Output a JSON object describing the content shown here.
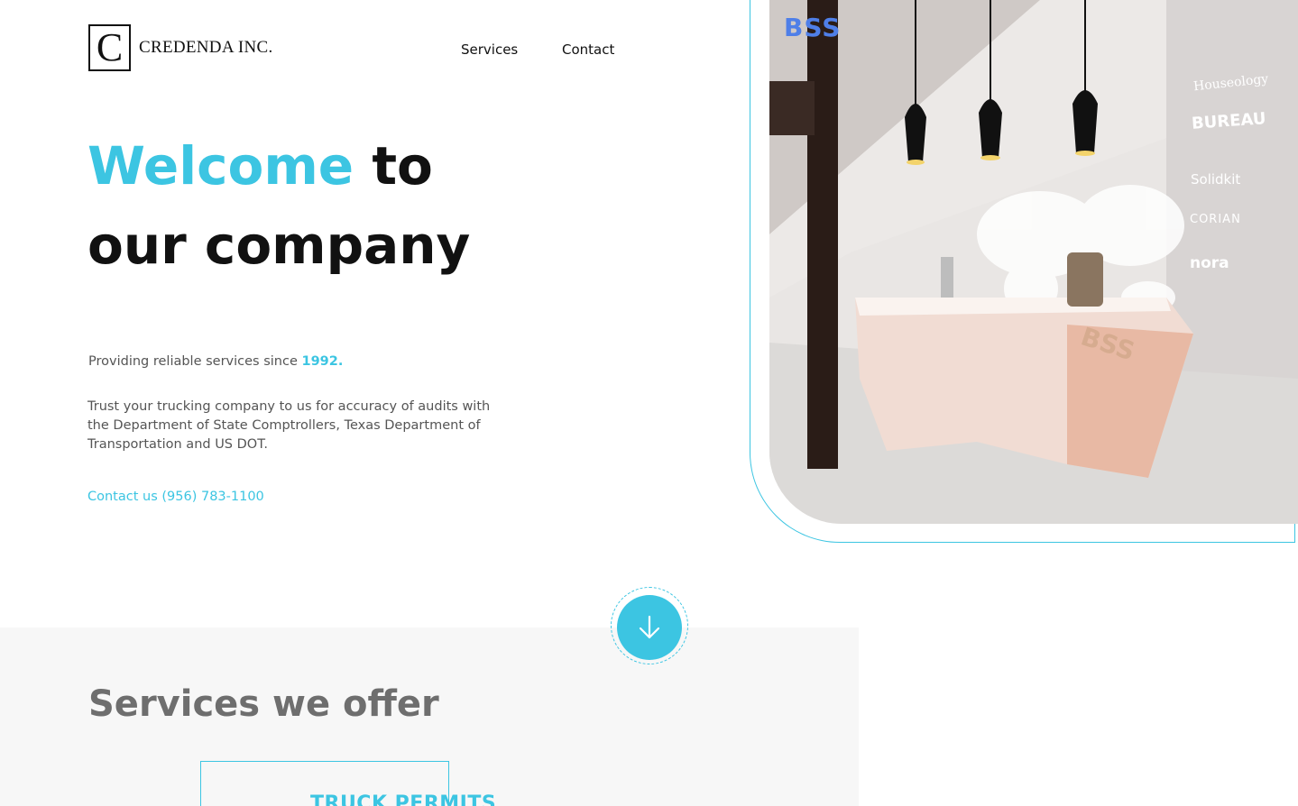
{
  "brand": {
    "logo_letter": "C",
    "name": "CREDENDA INC."
  },
  "nav": {
    "services": "Services",
    "contact": "Contact"
  },
  "hero": {
    "title_accent": "Welcome",
    "title_rest_1": " to",
    "title_line_2": "our company",
    "since_prefix": "Providing reliable services since ",
    "since_year": "1992.",
    "description": "Trust your trucking company to us for accuracy of audits with the Department of State Comptrollers, Texas Department of Transportation and US DOT.",
    "contact_link": "Contact us (956) 783-1100"
  },
  "photo": {
    "watermark": "BSS",
    "wall_brands": [
      "Houseology",
      "BUREAU",
      "Solidkit",
      "CORIAN",
      "nora"
    ],
    "desk_watermark": "BSS"
  },
  "scroll": {
    "icon": "arrow-down-icon"
  },
  "services": {
    "title": "Services we offer",
    "cards": [
      {
        "title": "TRUCK PERMITS"
      }
    ]
  },
  "colors": {
    "accent": "#3cc5e2",
    "section_bg": "#f7f7f7",
    "text_dark": "#111111",
    "text_muted": "#555555"
  }
}
